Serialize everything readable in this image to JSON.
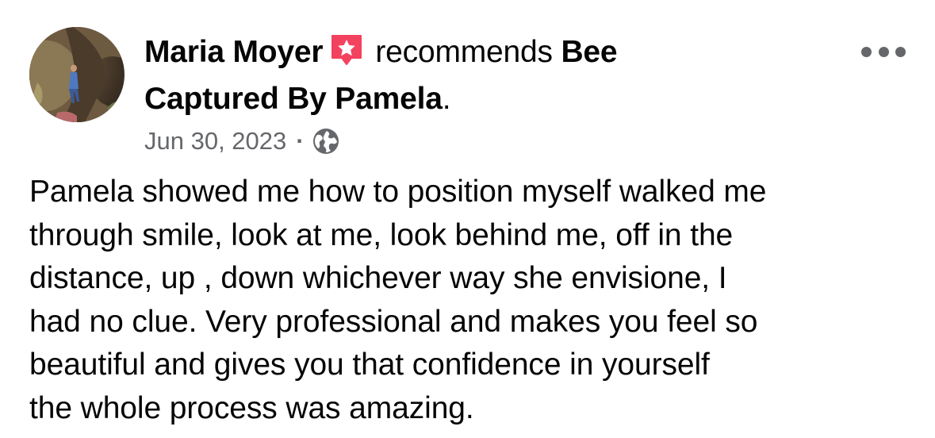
{
  "post": {
    "author": "Maria Moyer",
    "verb": "recommends",
    "page_line1": "Bee",
    "page_line2": "Captured By Pamela",
    "page_end": ".",
    "date": "Jun 30, 2023",
    "separator": "·",
    "privacy_icon": "globe-icon",
    "recommend_icon": "recommend-star-icon",
    "more_icon": "more-options-icon",
    "text_lines": [
      "Pamela showed me how to position myself walked me",
      "through smile, look at me, look behind me, off in the",
      "distance, up , down whichever way she envisione, I",
      "had no clue. Very professional and makes you feel so",
      "beautiful and gives you that confidence in yourself",
      "the whole process was amazing."
    ]
  },
  "colors": {
    "recommend_red": "#f3425f",
    "secondary_text": "#65676b",
    "primary_text": "#050505"
  }
}
